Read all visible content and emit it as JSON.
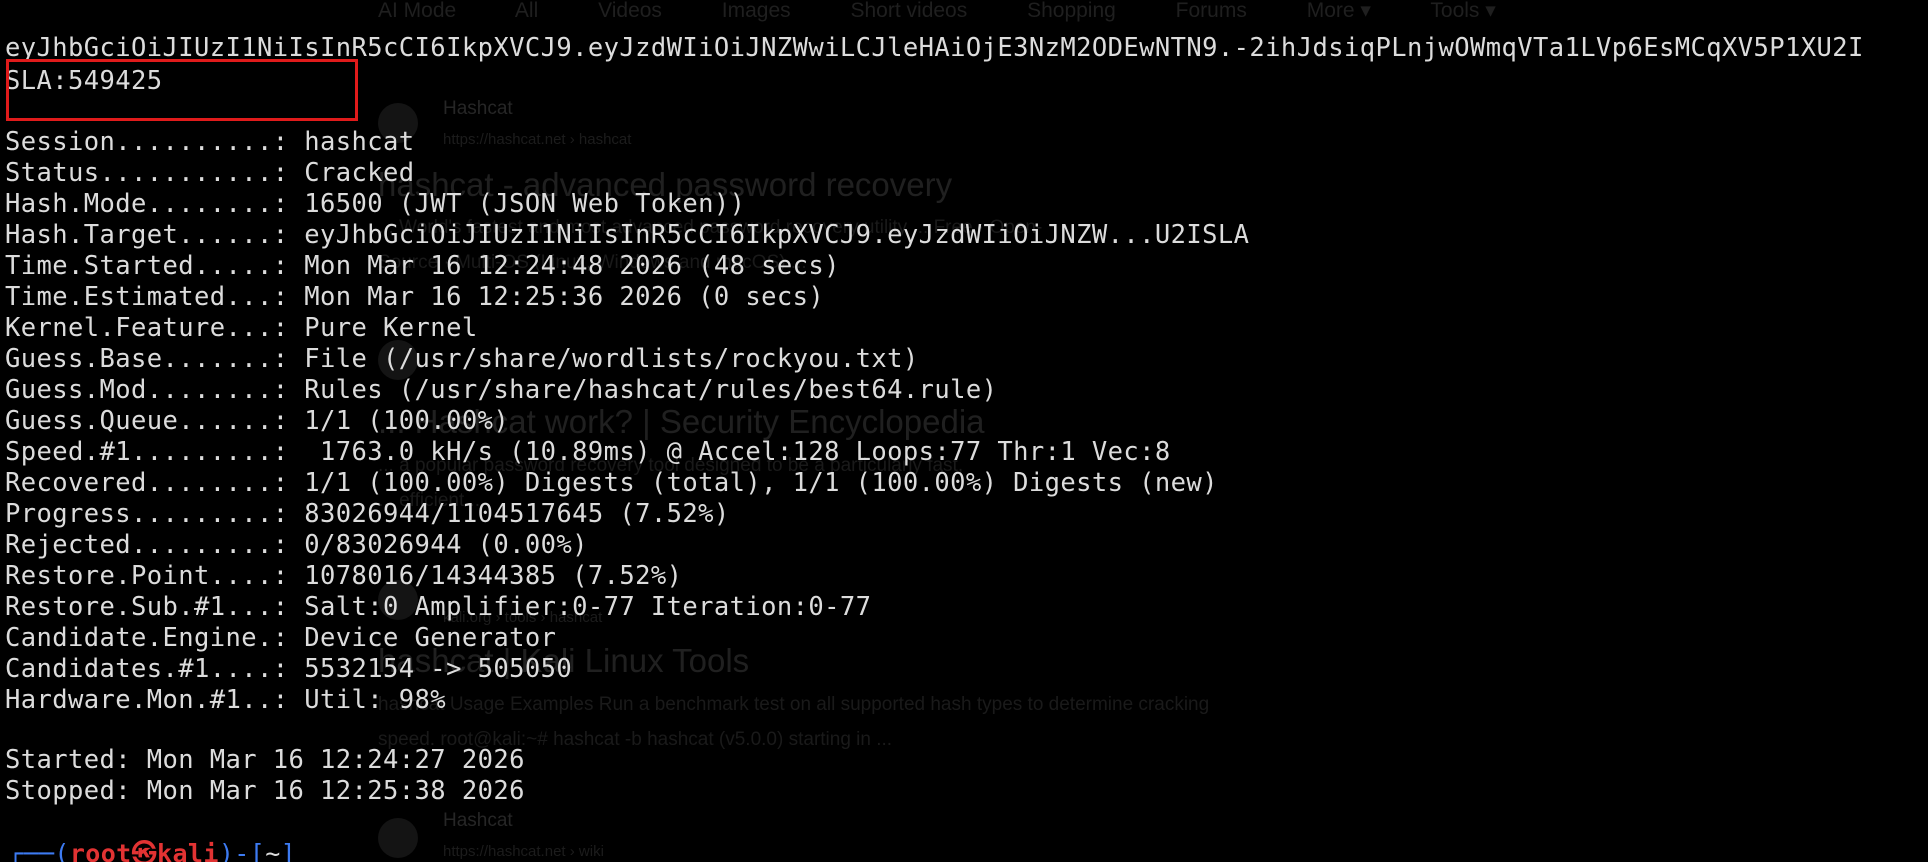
{
  "background_page": {
    "nav": [
      "AI Mode",
      "All",
      "Videos",
      "Images",
      "Short videos",
      "Shopping",
      "Forums",
      "More ▾",
      "Tools ▾"
    ],
    "result1": {
      "site": "Hashcat",
      "url": "https://hashcat.net › hashcat",
      "title": "hashcat - advanced password recovery",
      "snippet1": "... World's fastest and most advanced password recovery utility ... Free · Open-",
      "snippet2": "Source · Multi-OS (Linux, Windows and macOS) ..."
    },
    "result2": {
      "title": "... Hashcat work? | Security Encyclopedia",
      "snippet1": "... a popular password recovery tool designed to be a particularly fast,",
      "snippet2": "... efficient ..."
    },
    "result3": {
      "url": "kali.org › tools › hashcat",
      "title": "hashcat | Kali Linux Tools",
      "snippet1": "hashcat Usage Examples Run a benchmark test on all supported hash types to determine cracking",
      "snippet2": "speed. root@kali:~# hashcat -b hashcat (v5.0.0) starting in ..."
    },
    "result4": {
      "site": "Hashcat",
      "url": "https://hashcat.net › wiki"
    }
  },
  "terminal": {
    "token_line": "eyJhbGciOiJIUzI1NiIsInR5cCI6IkpXVCJ9.eyJzdWIiOiJNZWwiLCJleHAiOjE3NzM2ODEwNTN9.-2ihJdsiqPLnjwOWmqVTa1LVp6EsMCqXV5P1XU2I",
    "cracked_line": "SLA:549425",
    "status_lines": [
      "Session..........: hashcat",
      "Status...........: Cracked",
      "Hash.Mode........: 16500 (JWT (JSON Web Token))",
      "Hash.Target......: eyJhbGciOiJIUzI1NiIsInR5cCI6IkpXVCJ9.eyJzdWIiOiJNZW...U2ISLA",
      "Time.Started.....: Mon Mar 16 12:24:48 2026 (48 secs)",
      "Time.Estimated...: Mon Mar 16 12:25:36 2026 (0 secs)",
      "Kernel.Feature...: Pure Kernel",
      "Guess.Base.......: File (/usr/share/wordlists/rockyou.txt)",
      "Guess.Mod........: Rules (/usr/share/hashcat/rules/best64.rule)",
      "Guess.Queue......: 1/1 (100.00%)",
      "Speed.#1.........:  1763.0 kH/s (10.89ms) @ Accel:128 Loops:77 Thr:1 Vec:8",
      "Recovered........: 1/1 (100.00%) Digests (total), 1/1 (100.00%) Digests (new)",
      "Progress.........: 83026944/1104517645 (7.52%)",
      "Rejected.........: 0/83026944 (0.00%)",
      "Restore.Point....: 1078016/14344385 (7.52%)",
      "Restore.Sub.#1...: Salt:0 Amplifier:0-77 Iteration:0-77",
      "Candidate.Engine.: Device Generator",
      "Candidates.#1....: 5532154 -> 505050",
      "Hardware.Mon.#1..: Util: 98%"
    ],
    "started_line": "Started: Mon Mar 16 12:24:27 2026",
    "stopped_line": "Stopped: Mon Mar 16 12:25:38 2026",
    "prompt": {
      "corner": "┌──(",
      "user": "root㉿kali",
      "mid": ")-[",
      "dir": "~",
      "end": "]"
    }
  },
  "colors": {
    "background": "#000000",
    "text": "#dcdcdc",
    "highlight_box": "#e01b1b",
    "prompt_user": "#e23333",
    "prompt_bracket": "#3d7bf2"
  }
}
